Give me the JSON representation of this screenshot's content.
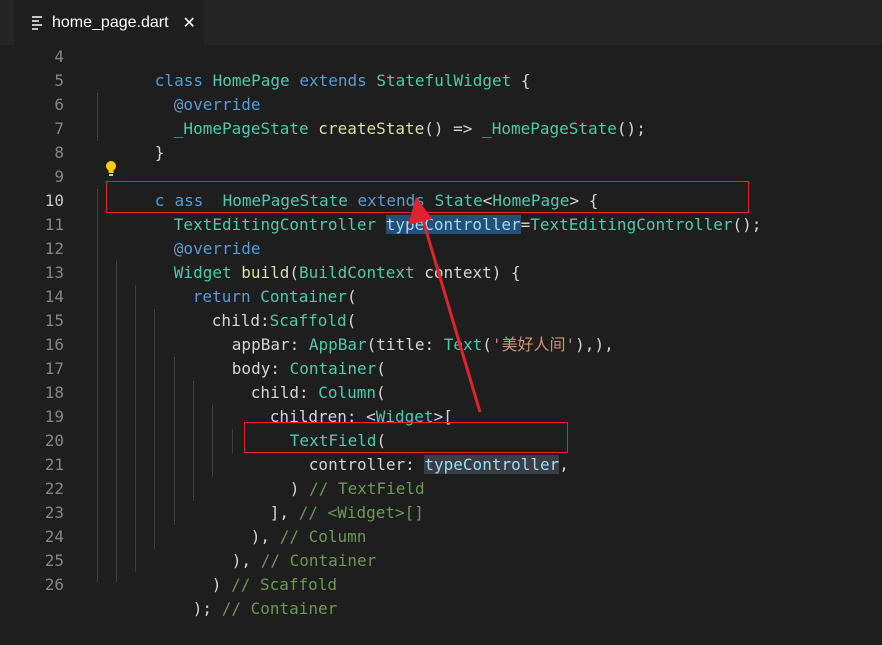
{
  "tab": {
    "filename": "home_page.dart",
    "close_glyph": "✕"
  },
  "line_numbers": [
    "4",
    "5",
    "6",
    "7",
    "8",
    "9",
    "10",
    "11",
    "12",
    "13",
    "14",
    "15",
    "16",
    "17",
    "18",
    "19",
    "20",
    "21",
    "22",
    "23",
    "24",
    "25",
    "26"
  ],
  "code": {
    "l4": [
      "class",
      " ",
      "HomePage",
      " ",
      "extends",
      " ",
      "StatefulWidget",
      " {"
    ],
    "l5": [
      "@override"
    ],
    "l6": [
      "_HomePageState",
      " ",
      "createState",
      "() => ",
      "_HomePageState",
      "();"
    ],
    "l7": [
      "}"
    ],
    "l9": [
      "c",
      "ass",
      " ",
      " HomePageState",
      " ",
      "extends",
      " ",
      "State",
      "<",
      "HomePage",
      "> {"
    ],
    "l10": [
      "TextEditingController",
      " ",
      "typeController",
      "=",
      "TextEditingController",
      "();"
    ],
    "l11": [
      "@override"
    ],
    "l12": [
      "Widget",
      " ",
      "build",
      "(",
      "BuildContext",
      " ",
      "context",
      ") {"
    ],
    "l13": [
      "return",
      " ",
      "Container",
      "("
    ],
    "l14": [
      "child:",
      "Scaffold",
      "("
    ],
    "l15": [
      "appBar: ",
      "AppBar",
      "(title: ",
      "Text",
      "(",
      "'美好人间'",
      "),),"
    ],
    "l16": [
      "body: ",
      "Container",
      "("
    ],
    "l17": [
      "child: ",
      "Column",
      "("
    ],
    "l18": [
      "children: ",
      "<",
      "Widget",
      ">["
    ],
    "l19": [
      "TextField",
      "("
    ],
    "l20": [
      "controller: ",
      "typeController",
      ","
    ],
    "l21": [
      ") ",
      "// TextField"
    ],
    "l22": [
      "], ",
      "// <Widget>[]"
    ],
    "l23": [
      "), ",
      "// Column"
    ],
    "l24": [
      "), ",
      "// Container"
    ],
    "l25": [
      ") ",
      "// Scaffold"
    ],
    "l26": [
      "); ",
      "// Container"
    ]
  },
  "colors": {
    "background": "#1e1e1e",
    "keyword": "#569cd6",
    "class": "#4ec9b0",
    "function": "#dcdcaa",
    "string": "#ce9178",
    "comment": "#6a9955",
    "annotation_box": "#e0232f"
  },
  "icons": {
    "file_icon": "file-lines-icon",
    "lightbulb": "lightbulb-icon"
  }
}
